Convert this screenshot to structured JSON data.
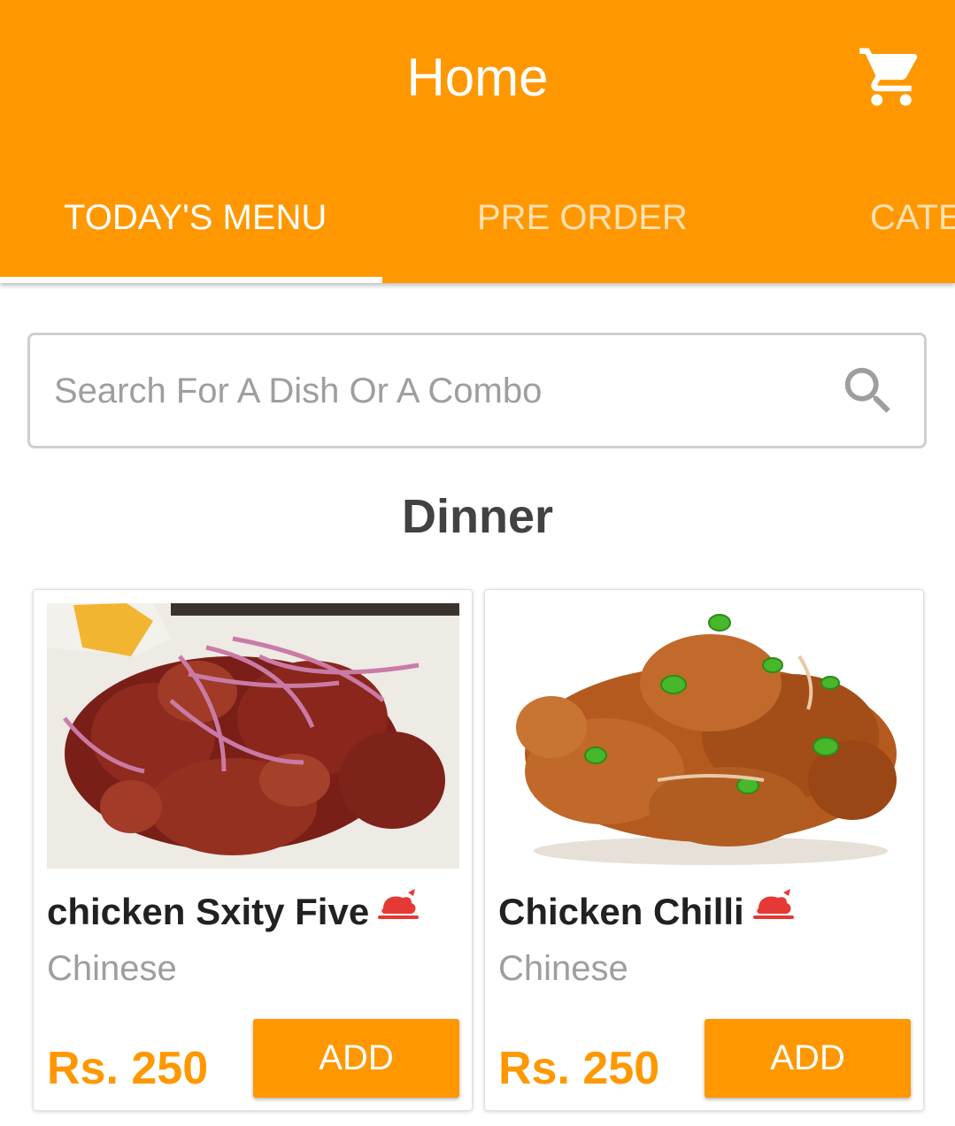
{
  "header": {
    "title": "Home",
    "cart_icon": "cart-icon"
  },
  "tabs": [
    {
      "label": "TODAY'S MENU",
      "active": true
    },
    {
      "label": "PRE ORDER",
      "active": false
    },
    {
      "label": "CATE",
      "active": false
    }
  ],
  "search": {
    "placeholder": "Search For A Dish Or A Combo",
    "value": "",
    "icon": "search-icon"
  },
  "section": {
    "title": "Dinner"
  },
  "dishes": [
    {
      "name": "chicken Sxity Five",
      "cuisine": "Chinese",
      "price": "Rs. 250",
      "add_label": "ADD",
      "diet_icon": "non-veg-chicken-icon"
    },
    {
      "name": "Chicken Chilli",
      "cuisine": "Chinese",
      "price": "Rs. 250",
      "add_label": "ADD",
      "diet_icon": "non-veg-chicken-icon"
    }
  ],
  "colors": {
    "primary": "#FF9800",
    "nonveg": "#E53935",
    "title_text": "#212121",
    "muted_text": "#9e9e9e"
  }
}
